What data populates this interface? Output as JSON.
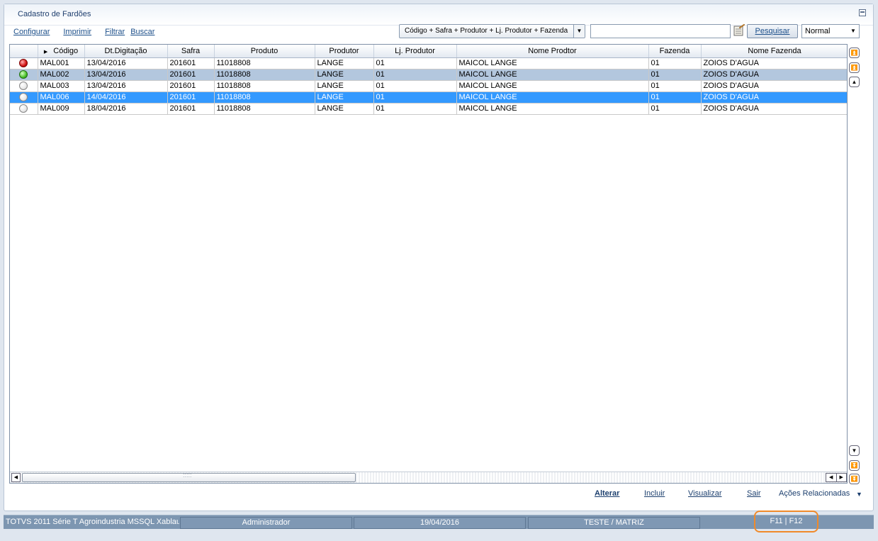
{
  "window": {
    "title": "Cadastro de Fardões"
  },
  "links": {
    "configurar": "Configurar",
    "imprimir": "Imprimir",
    "filtrar": "Filtrar",
    "buscar": "Buscar"
  },
  "search": {
    "order_value": "Código + Safra + Produtor + Lj. Produtor + Fazenda",
    "input_value": "",
    "button_label": "Pesquisar",
    "view_value": "Normal"
  },
  "grid": {
    "columns": [
      "",
      "Código",
      "Dt.Digitação",
      "Safra",
      "Produto",
      "Produtor",
      "Lj. Produtor",
      "Nome Prodtor",
      "Fazenda",
      "Nome Fazenda"
    ],
    "rows": [
      {
        "status": "red",
        "codigo": "MAL001",
        "data": "13/04/2016",
        "safra": "201601",
        "produto": "11018808",
        "produtor": "LANGE",
        "loja": "01",
        "nome_produtor": "MAICOL LANGE",
        "fazenda": "01",
        "nome_fazenda": "ZOIOS D'AGUA"
      },
      {
        "status": "green",
        "codigo": "MAL002",
        "data": "13/04/2016",
        "safra": "201601",
        "produto": "11018808",
        "produtor": "LANGE",
        "loja": "01",
        "nome_produtor": "MAICOL LANGE",
        "fazenda": "01",
        "nome_fazenda": "ZOIOS D'AGUA"
      },
      {
        "status": "white",
        "codigo": "MAL003",
        "data": "13/04/2016",
        "safra": "201601",
        "produto": "11018808",
        "produtor": "LANGE",
        "loja": "01",
        "nome_produtor": "MAICOL LANGE",
        "fazenda": "01",
        "nome_fazenda": "ZOIOS D'AGUA"
      },
      {
        "status": "white",
        "codigo": "MAL006",
        "data": "14/04/2016",
        "safra": "201601",
        "produto": "11018808",
        "produtor": "LANGE",
        "loja": "01",
        "nome_produtor": "MAICOL LANGE",
        "fazenda": "01",
        "nome_fazenda": "ZOIOS D'AGUA"
      },
      {
        "status": "white",
        "codigo": "MAL009",
        "data": "18/04/2016",
        "safra": "201601",
        "produto": "11018808",
        "produtor": "LANGE",
        "loja": "01",
        "nome_produtor": "MAICOL LANGE",
        "fazenda": "01",
        "nome_fazenda": "ZOIOS D'AGUA"
      }
    ]
  },
  "actions": {
    "alterar": "Alterar",
    "incluir": "Incluir",
    "visualizar": "Visualizar",
    "sair": "Sair",
    "relacionadas": "Ações Relacionadas"
  },
  "status_bar": {
    "system": "TOTVS 2011 Série T Agroindustria MSSQL Xablau",
    "user": "Administrador",
    "date": "19/04/2016",
    "company": "TESTE / MATRIZ",
    "keys": "F11 | F12"
  },
  "colors": {
    "selected_row": "#3399ff",
    "alt_row": "#b3c7de",
    "highlight": "#f08a2a"
  }
}
